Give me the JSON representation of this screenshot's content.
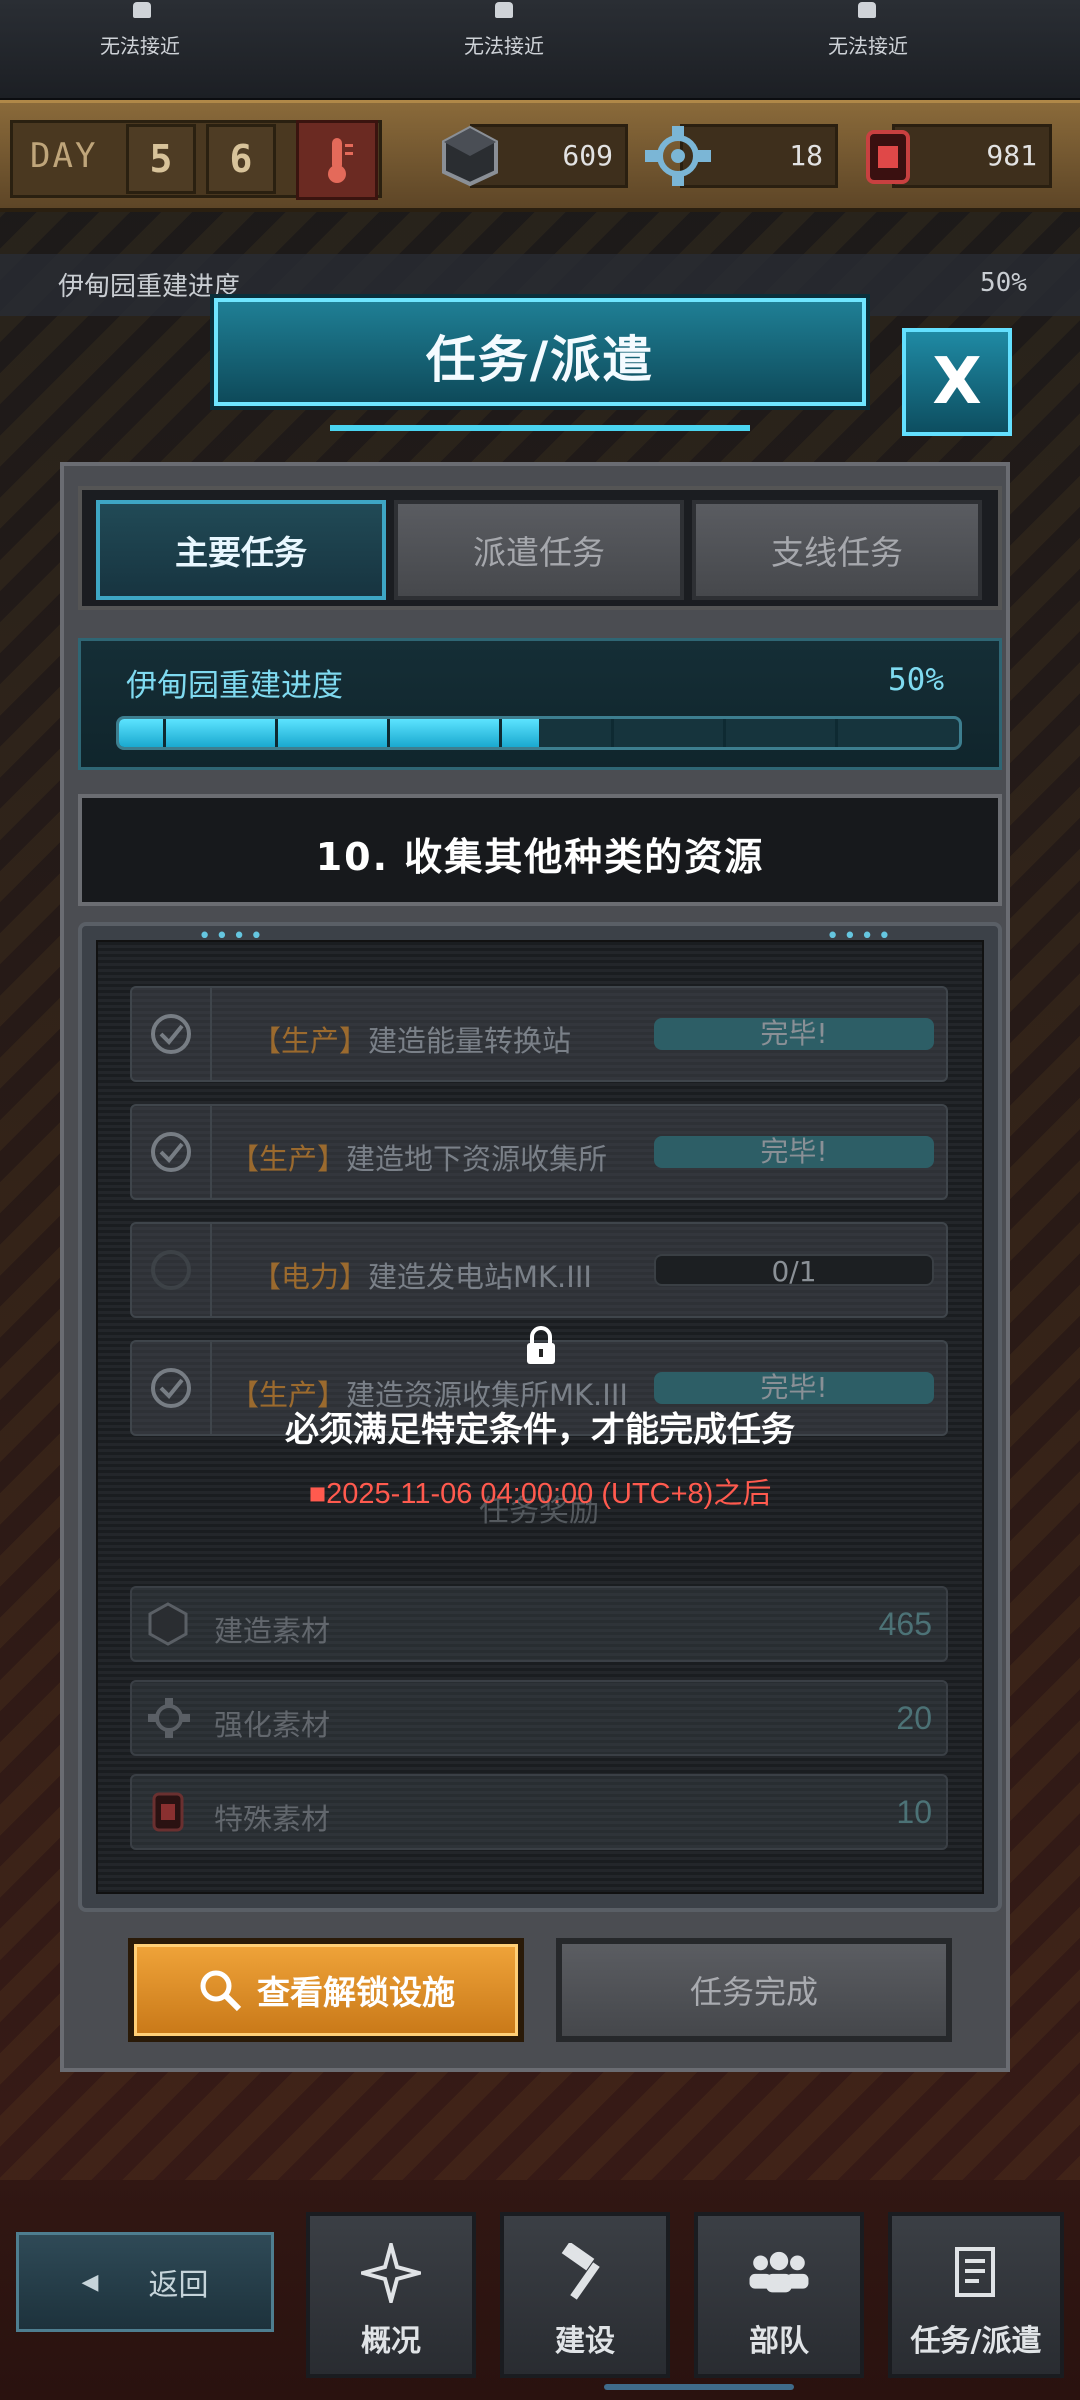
{
  "topbar": {
    "areas": [
      "无法接近",
      "无法接近",
      "无法接近"
    ]
  },
  "stats": {
    "day_label": "DAY",
    "day_digits": [
      "5",
      "6"
    ],
    "build_material": "609",
    "upgrade_material": "18",
    "special_material": "981"
  },
  "background_progress": {
    "label": "伊甸园重建进度",
    "percent": "50%"
  },
  "dialog": {
    "title": "任务/派遣",
    "close_label": "X",
    "tabs": [
      {
        "label": "主要任务",
        "active": true
      },
      {
        "label": "派遣任务",
        "active": false
      },
      {
        "label": "支线任务",
        "active": false
      }
    ],
    "progress": {
      "label": "伊甸园重建进度",
      "percent_text": "50%",
      "value": 0.5
    },
    "mission_title": "10. 收集其他种类的资源",
    "tasks": [
      {
        "tag": "【生产】",
        "text": "建造能量转换站",
        "status": "完毕!",
        "done": true
      },
      {
        "tag": "【生产】",
        "text": "建造地下资源收集所",
        "status": "完毕!",
        "done": true
      },
      {
        "tag": "【电力】",
        "text": "建造发电站MK.III",
        "status": "0/1",
        "done": false
      },
      {
        "tag": "【生产】",
        "text": "建造资源收集所MK.III",
        "status": "完毕!",
        "done": true
      }
    ],
    "rewards_label": "任务奖励",
    "rewards": [
      {
        "name": "建造素材",
        "value": "465"
      },
      {
        "name": "强化素材",
        "value": "20"
      },
      {
        "name": "特殊素材",
        "value": "10"
      }
    ],
    "lock_message": "必须满足特定条件，才能完成任务",
    "lock_date": "■2025-11-06 04:00:00 (UTC+8)之后",
    "view_button": "查看解锁设施",
    "complete_button": "任务完成"
  },
  "nav": {
    "back": "返回",
    "items": [
      "概况",
      "建设",
      "部队",
      "任务/派遣"
    ]
  },
  "colors": {
    "accent_cyan": "#4ad4f0",
    "button_orange": "#f0a43a",
    "warning_red": "#ff5a4e"
  }
}
